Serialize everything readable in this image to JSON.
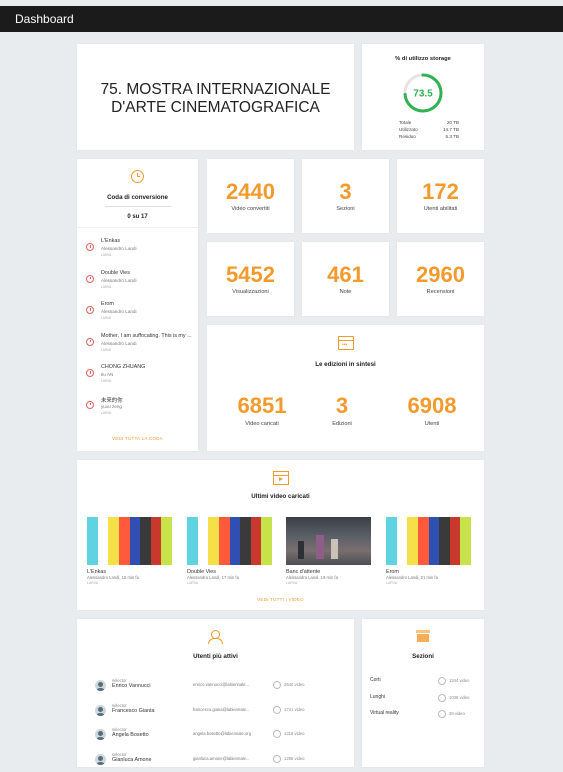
{
  "topbar": {
    "title": "Dashboard"
  },
  "festival": {
    "title_line1": "75. MOSTRA INTERNAZIONALE",
    "title_line2": "D'ARTE CINEMATOGRAFICA"
  },
  "storage": {
    "title": "% di utilizzo storage",
    "percent": "73.5",
    "percent_value": 73.5,
    "rows": [
      {
        "label": "Totale",
        "value": "20 TB"
      },
      {
        "label": "Utilizzato",
        "value": "14.7 TB"
      },
      {
        "label": "Residuo",
        "value": "5.3 TB"
      }
    ]
  },
  "queue": {
    "title": "Coda di conversione",
    "count": "0 su 17",
    "items": [
      {
        "title": "L'Enkas",
        "author": "Alessandro Landi",
        "status": "LARVA"
      },
      {
        "title": "Double Vies",
        "author": "Alessandro Landi",
        "status": "LARVA"
      },
      {
        "title": "Erom",
        "author": "Alessandro Landi",
        "status": "LARVA"
      },
      {
        "title": "Mother, I am suffocating. This is my ...",
        "author": "Alessandro Landi",
        "status": "LARVA"
      },
      {
        "title": "CHONG ZHUANG",
        "author": "Ilu AN",
        "status": "LARVA"
      },
      {
        "title": "未来的你",
        "author": "yuxu zeng",
        "status": "LARVA"
      }
    ],
    "link": "VEDI TUTTA LA CODA"
  },
  "stats": [
    {
      "value": "2440",
      "label": "Video convertiti"
    },
    {
      "value": "3",
      "label": "Sezioni"
    },
    {
      "value": "172",
      "label": "Utenti abilitati"
    },
    {
      "value": "5452",
      "label": "Visualizzazioni"
    },
    {
      "value": "461",
      "label": "Note"
    },
    {
      "value": "2960",
      "label": "Recensioni"
    }
  ],
  "summary": {
    "title": "Le edizioni in sintesi",
    "items": [
      {
        "value": "6851",
        "label": "Video caricati"
      },
      {
        "value": "3",
        "label": "Edizioni"
      },
      {
        "value": "6908",
        "label": "Utenti"
      }
    ]
  },
  "videos": {
    "title": "Ultimi video caricati",
    "items": [
      {
        "title": "L'Enkas",
        "meta": "Alessandro Landi, 15 min fa",
        "status": "LARVA"
      },
      {
        "title": "Double Vies",
        "meta": "Alessandra Landi, 17 min fa",
        "status": "LARVA"
      },
      {
        "title": "Banc d'attente",
        "meta": "Alessandra Landi, 19 min fa",
        "status": "LARVA"
      },
      {
        "title": "Erom",
        "meta": "Alessandro Landi, 21 min fa",
        "status": "LARVA"
      }
    ],
    "link": "VEDI TUTTI I VIDEO",
    "bar_colors": [
      "#5fd3e0",
      "#ffffff",
      "#f5e04a",
      "#ff5a3c",
      "#2f4fb3",
      "#3a3a3a",
      "#c8382c",
      "#c7e34a"
    ]
  },
  "users": {
    "title": "Utenti più attivi",
    "items": [
      {
        "role": "selector",
        "name": "Enrico Vannucci",
        "email": "enrico.vannucci@labiennale...",
        "count": "2640 video"
      },
      {
        "role": "selector",
        "name": "Francesco Gianta",
        "email": "francesco.giana@labiennale...",
        "count": "1741 video"
      },
      {
        "role": "selector",
        "name": "Angela Bosetto",
        "email": "angela.bosetto@labiennale.org",
        "count": "1316 video"
      },
      {
        "role": "selector",
        "name": "Gianluca Amone",
        "email": "gianluca.amone@labiennale...",
        "count": "1296 video"
      }
    ]
  },
  "sections": {
    "title": "Sezioni",
    "items": [
      {
        "name": "Corti",
        "count": "1344 video"
      },
      {
        "name": "Lunghi",
        "count": "1038 video"
      },
      {
        "name": "Virtual reality",
        "count": "39 video"
      }
    ]
  }
}
